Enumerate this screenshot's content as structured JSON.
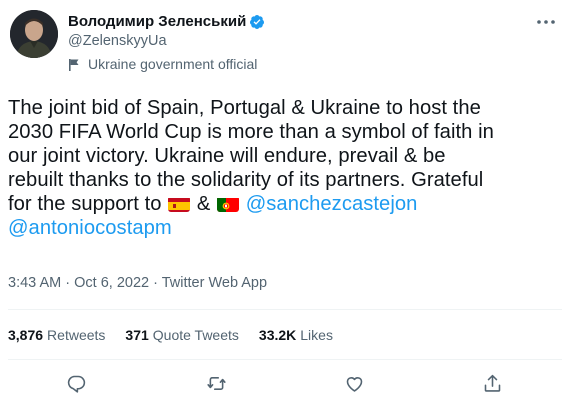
{
  "author": {
    "display_name": "Володимир Зеленський",
    "handle": "@ZelenskyyUa",
    "label": "Ukraine government official"
  },
  "tweet": {
    "lines": [
      "The joint bid of Spain, Portugal & Ukraine to host the",
      "2030 FIFA World Cup is more than a symbol of faith in",
      "our joint victory. Ukraine will endure, prevail & be",
      "rebuilt thanks to the solidarity of its partners. Grateful"
    ],
    "line5_prefix": "for the support to",
    "amp": "&",
    "mention1": "@sanchezcastejon",
    "mention2": "@antoniocostapm",
    "emojis": [
      "spain-flag",
      "portugal-flag"
    ]
  },
  "meta": {
    "time": "3:43 AM",
    "date": "Oct 6, 2022",
    "source": "Twitter Web App",
    "separator": "·"
  },
  "stats": {
    "retweets_count": "3,876",
    "retweets_label": "Retweets",
    "quotes_count": "371",
    "quotes_label": "Quote Tweets",
    "likes_count": "33.2K",
    "likes_label": "Likes"
  },
  "actions": [
    "reply-icon",
    "retweet-icon",
    "like-icon",
    "share-icon"
  ],
  "colors": {
    "text": "#0f1419",
    "secondary": "#536471",
    "link": "#1d9bf0",
    "divider": "#eff3f4"
  }
}
